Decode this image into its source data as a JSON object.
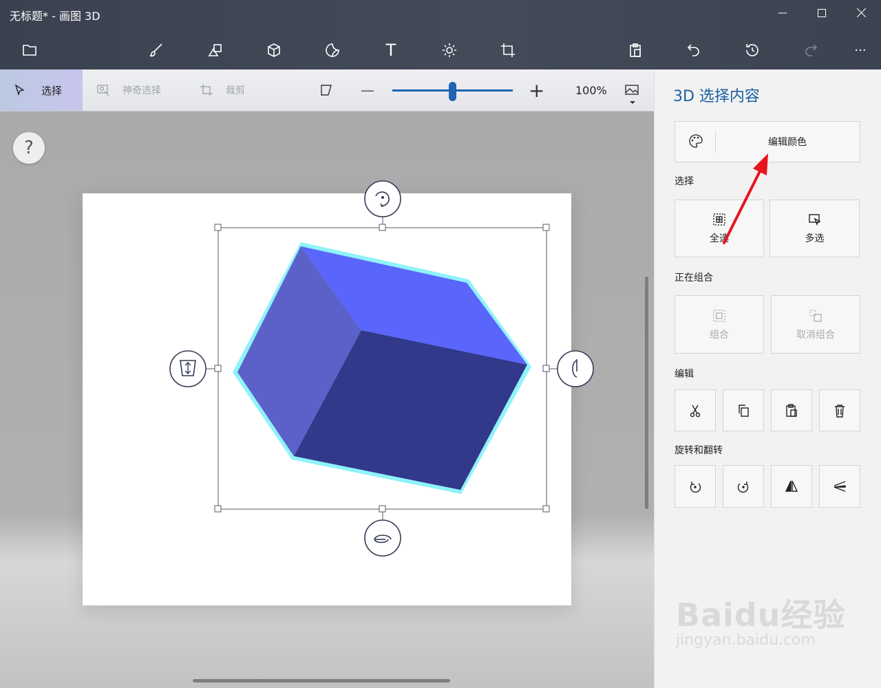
{
  "window": {
    "title": "无标题* - 画图 3D",
    "minimize_icon": "minimize-icon",
    "maximize_icon": "maximize-icon",
    "close_icon": "close-icon"
  },
  "toolbar": {
    "items": [
      "folder-icon",
      "brush-icon",
      "2d-shapes-icon",
      "3d-shapes-icon",
      "stickers-icon",
      "text-icon",
      "effects-icon",
      "canvas-icon",
      "paste-icon",
      "undo-icon",
      "history-icon",
      "redo-icon",
      "more-icon"
    ],
    "text_tool_glyph": "T",
    "more_glyph": "···"
  },
  "subtoolbar": {
    "select_label": "选择",
    "magic_select_label": "神奇选择",
    "crop_label": "裁剪",
    "zoom_out_glyph": "—",
    "zoom_in_glyph": "+",
    "zoom_value": "100%",
    "zoom_fraction": 0.5
  },
  "canvas": {
    "help_label": "?",
    "colors": {
      "cube_top": "#5a65fb",
      "cube_left": "#5c61c9",
      "cube_front": "#32388a",
      "outline": "#8ff3f9",
      "selection": "#555a66"
    }
  },
  "panel": {
    "title": "3D 选择内容",
    "edit_color_label": "编辑颜色",
    "select_section": "选择",
    "select_all_label": "全选",
    "multi_select_label": "多选",
    "group_section": "正在组合",
    "group_label": "组合",
    "ungroup_label": "取消组合",
    "edit_section": "编辑",
    "rotate_section": "旋转和翻转",
    "annotation_color": "#e8141b"
  },
  "watermark": {
    "brand": "Baidu经验",
    "url": "jingyan.baidu.com"
  }
}
